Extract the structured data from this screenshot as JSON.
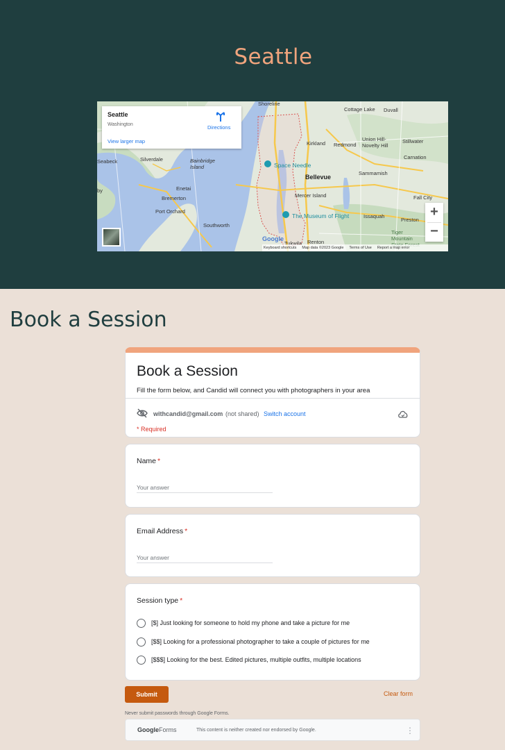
{
  "hero": {
    "title": "Seattle",
    "background_color": "#1f3e3f",
    "title_color": "#f0a47d"
  },
  "map": {
    "place_name": "Seattle",
    "place_region": "Washington",
    "directions_label": "Directions",
    "view_larger_label": "View larger map",
    "zoom_in": "+",
    "zoom_out": "−",
    "google_label": "Google",
    "footer": {
      "keyboard": "Keyboard shortcuts",
      "map_data": "Map data ©2023 Google",
      "terms": "Terms of Use",
      "report": "Report a map error"
    },
    "labels": {
      "shoreline": "Shoreline",
      "cottage_lake": "Cottage Lake",
      "duvall": "Duvall",
      "kirkland": "Kirkland",
      "redmond": "Redmond",
      "union_hill": "Union Hill-Novelty Hill",
      "stillwater": "Stillwater",
      "seabeck": "Seabeck",
      "silverdale": "Silverdale",
      "bainbridge": "Bainbridge Island",
      "space_needle": "Space Needle",
      "bellevue": "Bellevue",
      "sammamish": "Sammamish",
      "carnation": "Carnation",
      "enetai": "Enetai",
      "bremerton": "Bremerton",
      "mercer_island": "Mercer Island",
      "port_orchard": "Port Orchard",
      "issaquah": "Issaquah",
      "fall_city": "Fall City",
      "preston": "Preston",
      "museum_of_flight": "The Museum of Flight",
      "southworth": "Southworth",
      "tiger_mountain": "Tiger Mountain State Forest",
      "renton": "Renton",
      "tukwila": "Tukwila",
      "by": "by"
    }
  },
  "section": {
    "heading": "Book a Session"
  },
  "form": {
    "accent_color": "#f0a47d",
    "title": "Book a Session",
    "description": "Fill the form below, and Candid will connect you with photographers in your area",
    "account_email": "withcandid@gmail.com",
    "not_shared": "(not shared)",
    "switch_account": "Switch account",
    "required_note": "* Required",
    "questions": [
      {
        "title": "Name",
        "required_mark": "*",
        "placeholder": "Your answer"
      },
      {
        "title": "Email Address",
        "required_mark": "*",
        "placeholder": "Your answer"
      },
      {
        "title": "Session type",
        "required_mark": "*",
        "options": [
          "[$] Just looking for someone to hold my phone and take a picture for me",
          "[$$] Looking for a professional photographer to take a couple of pictures for me",
          "[$$$] Looking for the best. Edited pictures, multiple outfits, multiple locations"
        ]
      }
    ],
    "submit_label": "Submit",
    "submit_color": "#c55a0f",
    "clear_label": "Clear form",
    "never_note": "Never submit passwords through Google Forms.",
    "footer_brand_google": "Google",
    "footer_brand_forms": "Forms",
    "footer_disclaimer": "This content is neither created nor endorsed by Google."
  }
}
